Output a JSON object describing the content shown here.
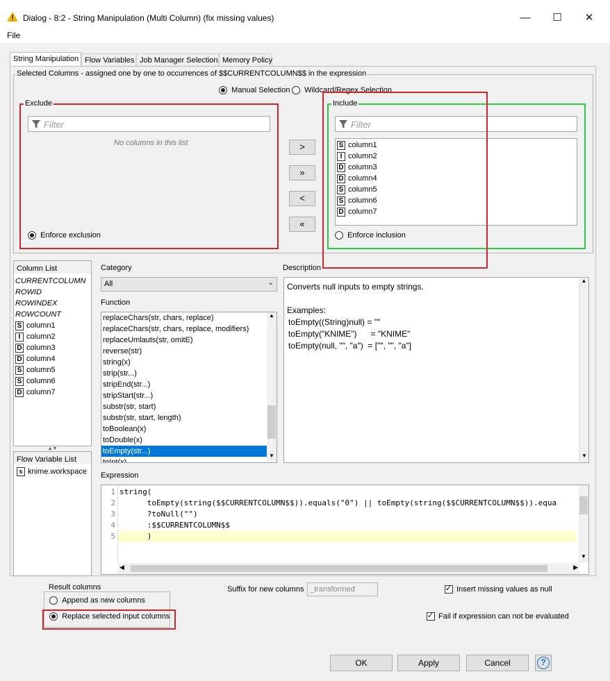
{
  "window": {
    "title": "Dialog - 8:2 - String Manipulation (Multi Column) (fix missing values)",
    "menu_file": "File"
  },
  "tabs": [
    "String Manipulation",
    "Flow Variables",
    "Job Manager Selection",
    "Memory Policy"
  ],
  "selected_columns": {
    "legend": "Selected Columns - assigned one by one to occurrences of $$CURRENTCOLUMN$$ in the expression",
    "manual_label": "Manual Selection",
    "wildcard_label": "Wildcard/Regex Selection",
    "exclude": {
      "legend": "Exclude",
      "filter_placeholder": "Filter",
      "empty_text": "No columns in this list",
      "enforce_label": "Enforce exclusion"
    },
    "include": {
      "legend": "Include",
      "filter_placeholder": "Filter",
      "enforce_label": "Enforce inclusion",
      "columns": [
        {
          "type": "S",
          "name": "column1"
        },
        {
          "type": "I",
          "name": "column2"
        },
        {
          "type": "D",
          "name": "column3"
        },
        {
          "type": "D",
          "name": "column4"
        },
        {
          "type": "S",
          "name": "column5"
        },
        {
          "type": "S",
          "name": "column6"
        },
        {
          "type": "D",
          "name": "column7"
        }
      ]
    },
    "move_buttons": [
      ">",
      "»",
      "<",
      "«"
    ]
  },
  "column_list": {
    "header": "Column List",
    "special": [
      "CURRENTCOLUMN",
      "ROWID",
      "ROWINDEX",
      "ROWCOUNT"
    ],
    "columns": [
      {
        "type": "S",
        "name": "column1"
      },
      {
        "type": "I",
        "name": "column2"
      },
      {
        "type": "D",
        "name": "column3"
      },
      {
        "type": "D",
        "name": "column4"
      },
      {
        "type": "S",
        "name": "column5"
      },
      {
        "type": "S",
        "name": "column6"
      },
      {
        "type": "D",
        "name": "column7"
      }
    ]
  },
  "flow_variable_list": {
    "header": "Flow Variable List",
    "items": [
      {
        "type": "s",
        "name": "knime.workspace"
      }
    ]
  },
  "category": {
    "label": "Category",
    "value": "All"
  },
  "function": {
    "label": "Function",
    "items": [
      "replaceChars(str, chars, replace)",
      "replaceChars(str, chars, replace, modifiers)",
      "replaceUmlauts(str, omitE)",
      "reverse(str)",
      "string(x)",
      "strip(str...)",
      "stripEnd(str...)",
      "stripStart(str...)",
      "substr(str, start)",
      "substr(str, start, length)",
      "toBoolean(x)",
      "toDouble(x)",
      "toEmpty(str...)",
      "toInt(x)"
    ],
    "selected_index": 12
  },
  "description": {
    "label": "Description",
    "lines": [
      "Converts null inputs to empty strings.",
      "",
      "Examples:",
      "toEmpty((String)null) = \"\"",
      "toEmpty(\"KNIME\")      = \"KNIME\"",
      "toEmpty(null, \"\", \"a\")  = [\"\", \"\", \"a\"]"
    ]
  },
  "expression": {
    "label": "Expression",
    "line_numbers": [
      "1",
      "2",
      "3",
      "4",
      "5"
    ],
    "lines": [
      "string(",
      "      toEmpty(string($$CURRENTCOLUMN$$)).equals(\"0\") || toEmpty(string($$CURRENTCOLUMN$$)).equa",
      "      ?toNull(\"\")",
      "      :$$CURRENTCOLUMN$$",
      "      )"
    ]
  },
  "result_columns": {
    "legend": "Result columns",
    "append_label": "Append as new columns",
    "replace_label": "Replace selected input columns"
  },
  "suffix": {
    "label": "Suffix for new columns",
    "placeholder": "_transformed"
  },
  "insert_missing_label": "Insert missing values as null",
  "fail_label": "Fail if expression can not be evaluated",
  "buttons": {
    "ok": "OK",
    "apply": "Apply",
    "cancel": "Cancel",
    "help": "?"
  },
  "colors": {
    "highlight_red": "#d0272d",
    "include_green": "#2ecc40",
    "selection_blue": "#0078d7"
  }
}
